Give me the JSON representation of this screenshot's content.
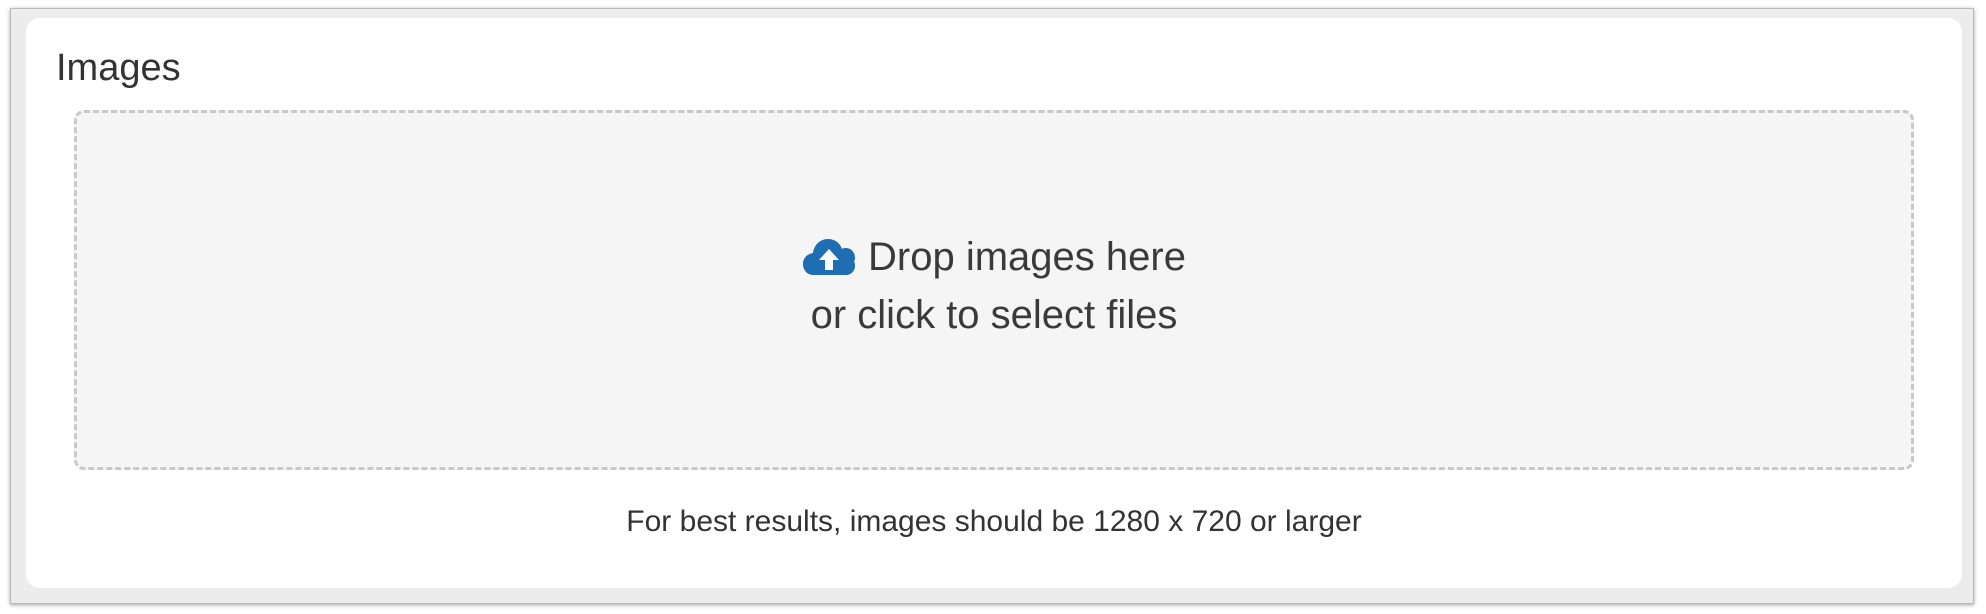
{
  "images_section": {
    "title": "Images",
    "dropzone": {
      "icon": "cloud-upload-icon",
      "icon_color": "#1f6db3",
      "line1": "Drop images here",
      "line2": "or click to select files"
    },
    "hint": "For best results, images should be 1280 x 720 or larger"
  }
}
